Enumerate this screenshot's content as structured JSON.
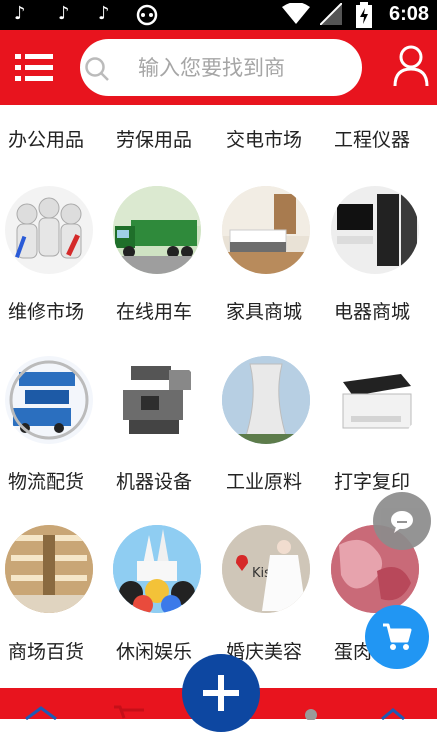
{
  "status_bar": {
    "time": "6:08",
    "left_icons": [
      "tiktok-icon",
      "tiktok-icon",
      "tiktok-icon",
      "headset-icon"
    ],
    "right_icons": [
      "wifi-icon",
      "signal-icon",
      "battery-icon"
    ]
  },
  "header": {
    "menu_icon": "list-icon",
    "search_placeholder": "输入您要找到商",
    "user_icon": "user-icon",
    "background_color": "#e8141e"
  },
  "categories": [
    {
      "label": "办公用品"
    },
    {
      "label": "劳保用品"
    },
    {
      "label": "交电市场"
    },
    {
      "label": "工程仪器"
    },
    {
      "label": "维修市场",
      "image": "workers-with-tools"
    },
    {
      "label": "在线用车",
      "image": "green-truck"
    },
    {
      "label": "家具商城",
      "image": "bedroom"
    },
    {
      "label": "电器商城",
      "image": "tv-fridge"
    },
    {
      "label": "物流配货",
      "image": "logistics-truck"
    },
    {
      "label": "机器设备",
      "image": "machine"
    },
    {
      "label": "工业原料",
      "image": "cooling-tower"
    },
    {
      "label": "打字复印",
      "image": "printer"
    },
    {
      "label": "商场百货",
      "image": "mall-interior"
    },
    {
      "label": "休闲娱乐",
      "image": "disney-characters"
    },
    {
      "label": "婚庆美容",
      "image": "bride"
    },
    {
      "label": "蛋肉",
      "image": "meat"
    }
  ],
  "floating": {
    "chat_icon": "chat-bubble-icon",
    "cart_icon": "cart-icon"
  },
  "bottom_nav": {
    "center_icon": "plus-icon",
    "accent_color": "#0d47a1"
  }
}
